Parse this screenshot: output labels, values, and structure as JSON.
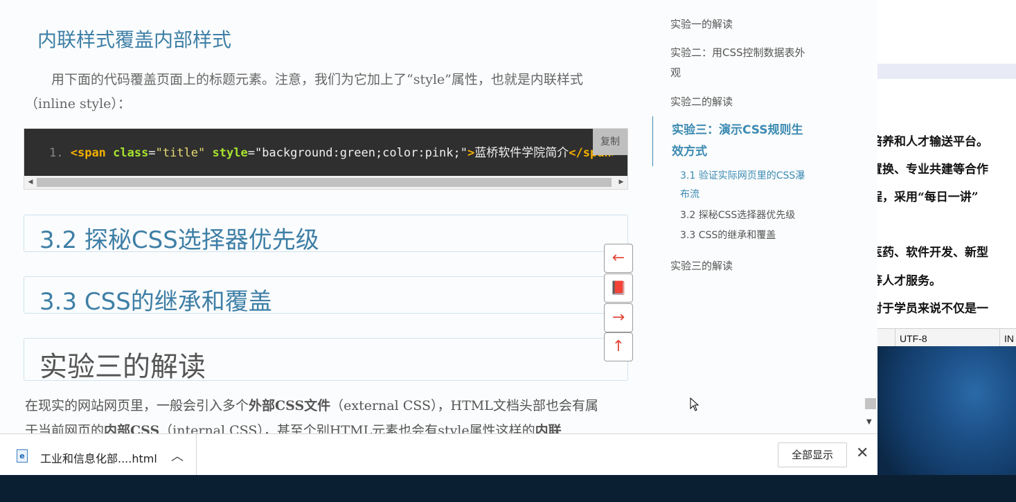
{
  "main": {
    "heading_inline": "内联样式覆盖内部样式",
    "para1_line1": "用下面的代码覆盖页面上的标题元素。注意，我们为它加上了“style”属性，也就是内联样式",
    "para1_line2": "（inline style）：",
    "code": {
      "line_number": "1.",
      "open_tag": "<span",
      "attr1": "class",
      "eq1": "=",
      "val1": "\"title\"",
      "attr2": "style",
      "eq2": "=",
      "val2": "\"background:green;color:pink;\"",
      "close_bracket": ">",
      "text": "蓝桥软件学院简介",
      "close_tag": "</span>",
      "copy_label": "复制"
    },
    "section_32": "3.2 探秘CSS选择器优先级",
    "section_33": "3.3 CSS的继承和覆盖",
    "section_exp3": "实验三的解读",
    "para2_line1_a": "在现实的网站网页里，一般会引入多个",
    "para2_line1_b": "外部CSS文件",
    "para2_line1_c": "（external CSS），HTML文档头部也会有属",
    "para2_line2_a": "于当前网页的",
    "para2_line2_b": "内部CSS",
    "para2_line2_c": "（internal CSS），甚至个别HTML元素也会有style属性这样的",
    "para2_line2_d": "内联"
  },
  "nav_buttons": {
    "prev": "←",
    "book": "📕",
    "next": "→",
    "top": "↑"
  },
  "toc": {
    "items": [
      "实验一的解读",
      "实验二：用CSS控制数据表外",
      "观",
      "实验二的解读",
      "实验三：演示CSS规则生",
      "效方式",
      "3.1 验证实际网页里的CSS瀑",
      "布流",
      "3.2 探秘CSS选择器优先级",
      "3.3 CSS的继承和覆盖",
      "实验三的解读"
    ]
  },
  "download_bar": {
    "file_name": "工业和信息化部....html",
    "show_all": "全部显示",
    "close": "✕"
  },
  "background_doc": {
    "lines": [
      "培养和人才输送平台。",
      "置换、专业共建等合作",
      "程，采用“每日一讲”",
      "医药、软件开发、新型",
      "等人才服务。",
      "对于学员来说不仅是一"
    ],
    "status_encoding": "UTF-8",
    "status_ins": "IN"
  },
  "colors": {
    "accent": "#3b8ab2",
    "heading": "#3e7fa6",
    "code_bg": "#2f2f2f",
    "nav_arrow": "#e24a3b"
  }
}
